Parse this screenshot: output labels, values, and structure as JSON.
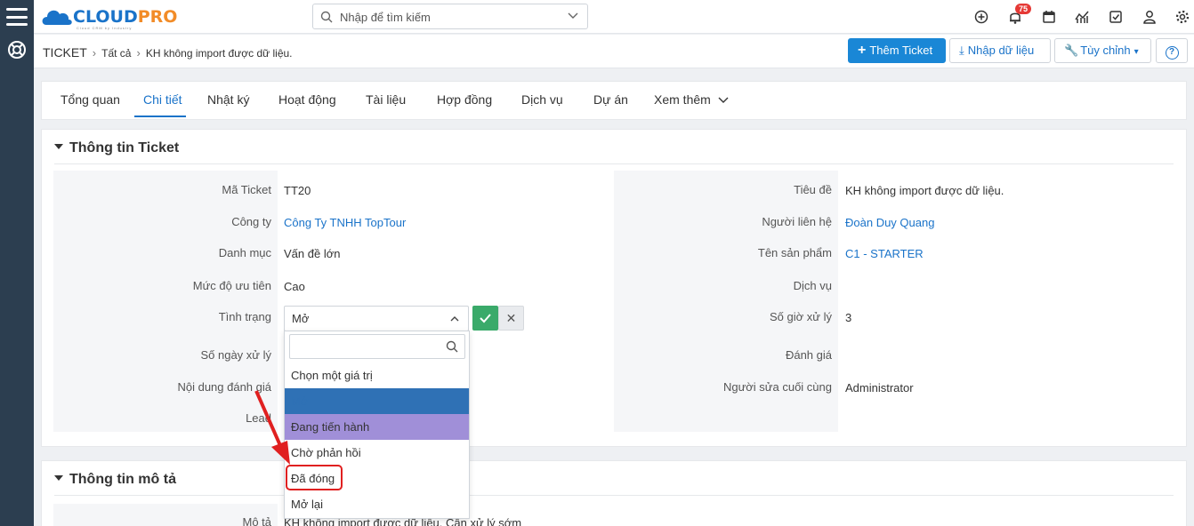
{
  "brand": {
    "name_a": "CLOUD",
    "name_b": "PRO",
    "tagline": "Cloud CRM by Industry"
  },
  "search": {
    "placeholder": "Nhập để tìm kiếm"
  },
  "notifications": {
    "count": "75"
  },
  "breadcrumb": {
    "module": "TICKET",
    "all": "Tất cả",
    "current": "KH không import được dữ liệu."
  },
  "actions": {
    "add": "Thêm Ticket",
    "import": "Nhập dữ liệu",
    "customize": "Tùy chỉnh",
    "help": "?"
  },
  "tabs": [
    "Tổng quan",
    "Chi tiết",
    "Nhật ký",
    "Hoạt động",
    "Tài liệu",
    "Hợp đồng",
    "Dịch vụ",
    "Dự án",
    "Xem thêm"
  ],
  "active_tab": "Chi tiết",
  "section_info": {
    "title": "Thông tin Ticket",
    "left": [
      {
        "label": "Mã Ticket",
        "value": "TT20"
      },
      {
        "label": "Công ty",
        "value": "Công Ty TNHH TopTour"
      },
      {
        "label": "Danh mục",
        "value": "Vấn đề lớn"
      },
      {
        "label": "Mức độ ưu tiên",
        "value": "Cao"
      },
      {
        "label": "Tình trạng",
        "value": "Mở"
      },
      {
        "label": "Số ngày xử lý",
        "value": ""
      },
      {
        "label": "Nội dung đánh giá",
        "value": ""
      },
      {
        "label": "Lead",
        "value": ""
      }
    ],
    "right": [
      {
        "label": "Tiêu đề",
        "value": "KH không import được dữ liệu."
      },
      {
        "label": "Người liên hệ",
        "value": "Đoàn Duy Quang"
      },
      {
        "label": "Tên sản phẩm",
        "value": "C1 - STARTER"
      },
      {
        "label": "Dịch vụ",
        "value": ""
      },
      {
        "label": "Số giờ xử lý",
        "value": "3"
      },
      {
        "label": "Đánh giá",
        "value": ""
      },
      {
        "label": "Người sửa cuối cùng",
        "value": "Administrator"
      }
    ]
  },
  "status_dropdown": {
    "selected": "Mở",
    "options": [
      "Chọn một giá trị",
      "Mở",
      "Đang tiến hành",
      "Chờ phản hồi",
      "Đã đóng",
      "Mở lại"
    ],
    "hovered": "Đang tiến hành",
    "highlighted": "Đã đóng"
  },
  "section_desc": {
    "title": "Thông tin mô tả",
    "label": "Mô tả",
    "value": "KH không import được dữ liệu. Cần xử lý sớm"
  },
  "colors": {
    "primary": "#1a87d6",
    "link": "#1a73c9",
    "rail": "#2c3e50",
    "confirm": "#3aaa6a",
    "annotation": "#e02020"
  }
}
